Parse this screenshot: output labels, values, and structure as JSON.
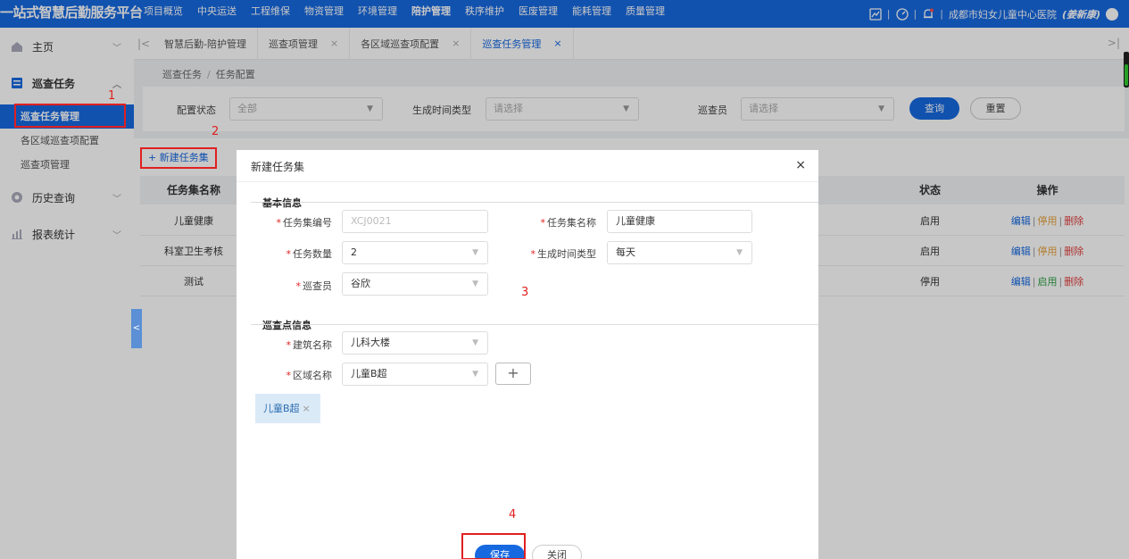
{
  "topbar": {
    "brand": "一站式智慧后勤服务平台",
    "nav": [
      "项目概览",
      "中央运送",
      "工程维保",
      "物资管理",
      "环境管理",
      "陪护管理",
      "秩序维护",
      "医废管理",
      "能耗管理",
      "质量管理"
    ],
    "active_nav": "陪护管理",
    "hospital": "成都市妇女儿童中心医院",
    "user": "(姜新康)",
    "separator": "|"
  },
  "sidebar": {
    "home": "主页",
    "patrol_task": "巡查任务",
    "sub_items": [
      "巡查任务管理",
      "各区域巡查项配置",
      "巡查项管理"
    ],
    "history": "历史查询",
    "report": "报表统计"
  },
  "tabs": {
    "items": [
      "智慧后勤-陪护管理",
      "巡查项管理",
      "各区域巡查项配置",
      "巡查任务管理"
    ],
    "close_glyph": "×"
  },
  "breadcrumb": {
    "parent": "巡查任务",
    "separator": "/",
    "current": "任务配置"
  },
  "filters": {
    "status_label": "配置状态",
    "status_value": "全部",
    "gen_type_label": "生成时间类型",
    "gen_type_placeholder": "请选择",
    "inspector_label": "巡查员",
    "inspector_placeholder": "请选择",
    "query": "查询",
    "reset": "重置"
  },
  "new_button": "+ 新建任务集",
  "table": {
    "headers": {
      "name": "任务集名称",
      "status": "状态",
      "actions": "操作"
    },
    "rows": [
      {
        "name": "儿童健康",
        "status": "启用",
        "toggle": "停用"
      },
      {
        "name": "科室卫生考核",
        "status": "启用",
        "toggle": "停用"
      },
      {
        "name": "测试",
        "status": "停用",
        "toggle": "启用"
      }
    ],
    "edit": "编辑",
    "delete": "删除",
    "bar": "|"
  },
  "modal": {
    "title": "新建任务集",
    "close": "×",
    "basic_section": "基本信息",
    "code_label": "任务集编号",
    "code_placeholder": "XCJ0021",
    "name_label": "任务集名称",
    "name_value": "儿童健康",
    "count_label": "任务数量",
    "count_value": "2",
    "gen_type_label": "生成时间类型",
    "gen_type_value": "每天",
    "inspector_label": "巡查员",
    "inspector_value": "谷欣",
    "point_section": "巡查点信息",
    "building_label": "建筑名称",
    "building_value": "儿科大楼",
    "area_label": "区域名称",
    "area_value": "儿童B超",
    "plus": "+",
    "chip": "儿童B超",
    "chip_close": "×",
    "save": "保存",
    "close_btn": "关闭"
  },
  "annotations": [
    "1",
    "2",
    "3",
    "4"
  ],
  "colors": {
    "primary": "#1769e0",
    "annotation": "#e02020"
  }
}
